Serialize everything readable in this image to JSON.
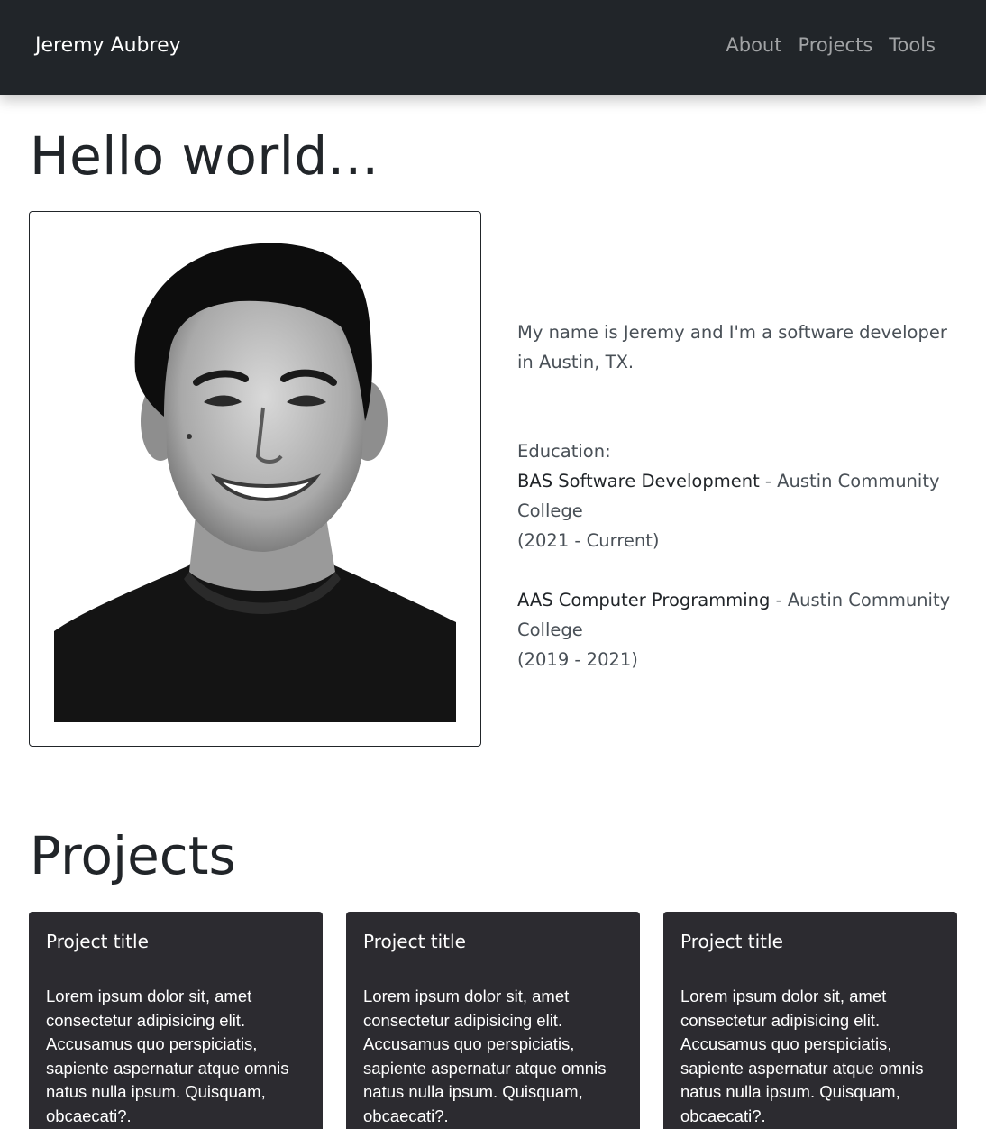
{
  "navbar": {
    "brand": "Jeremy Aubrey",
    "links": [
      "About",
      "Projects",
      "Tools"
    ]
  },
  "hero": {
    "title": "Hello world...",
    "photo_alt": "portrait-photo"
  },
  "about": {
    "intro": "My name is Jeremy and I'm a software developer in Austin, TX.",
    "education_label": "Education:",
    "education": [
      {
        "degree": "BAS Software Development",
        "separator": " - ",
        "school": "Austin Community College",
        "years": "(2021 - Current)"
      },
      {
        "degree": "AAS Computer Programming",
        "separator": " - ",
        "school": "Austin Community College",
        "years": "(2019 - 2021)"
      }
    ]
  },
  "projects": {
    "title": "Projects",
    "cards": [
      {
        "title": "Project title",
        "text": "Lorem ipsum dolor sit, amet consectetur adipisicing elit. Accusamus quo perspiciatis, sapiente aspernatur atque omnis natus nulla ipsum. Quisquam, obcaecati?."
      },
      {
        "title": "Project title",
        "text": "Lorem ipsum dolor sit, amet consectetur adipisicing elit. Accusamus quo perspiciatis, sapiente aspernatur atque omnis natus nulla ipsum. Quisquam, obcaecati?."
      },
      {
        "title": "Project title",
        "text": "Lorem ipsum dolor sit, amet consectetur adipisicing elit. Accusamus quo perspiciatis, sapiente aspernatur atque omnis natus nulla ipsum. Quisquam, obcaecati?."
      }
    ]
  }
}
